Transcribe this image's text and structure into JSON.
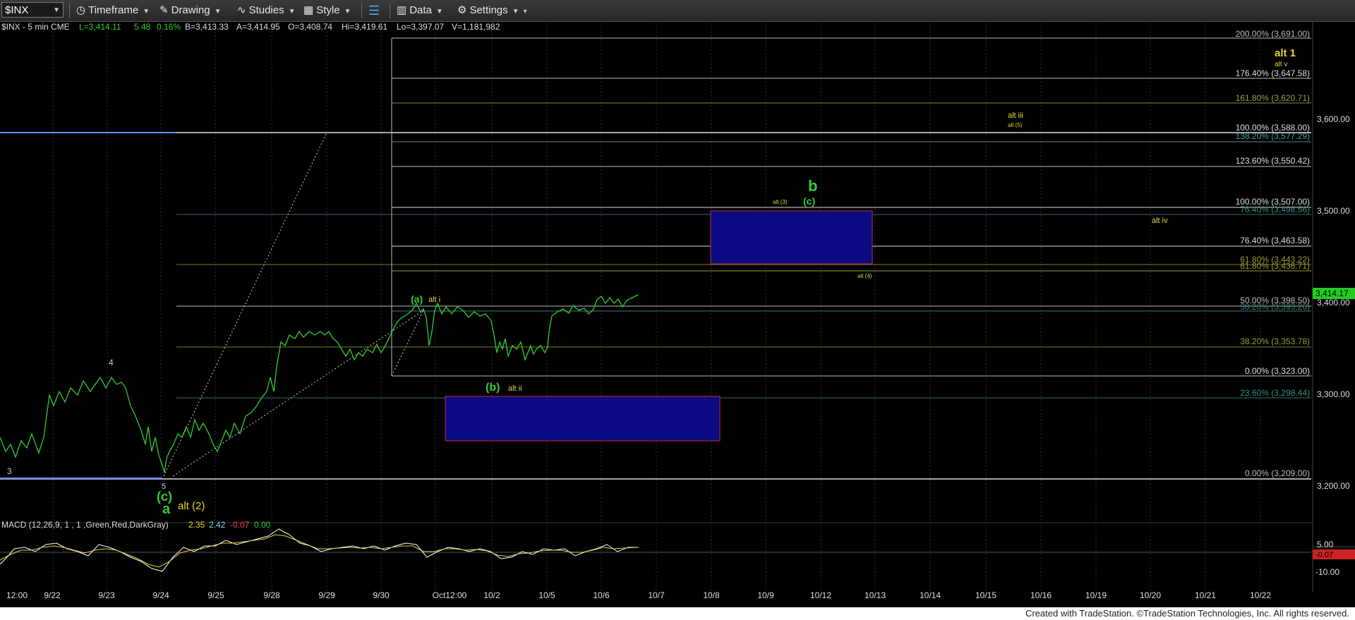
{
  "toolbar": {
    "symbol": "$INX",
    "timeframe": "Timeframe",
    "drawing": "Drawing",
    "studies": "Studies",
    "style": "Style",
    "data": "Data",
    "settings": "Settings"
  },
  "header": {
    "title": "$INX - 5 min  CME",
    "L": "L=3,414.11",
    "chg": "5.48",
    "pct": "0.16%",
    "B": "B=3,413.33",
    "A": "A=3,414.95",
    "O": "O=3,408.74",
    "Hi": "Hi=3,419.61",
    "Lo": "Lo=3,397.07",
    "V": "V=1,181,982"
  },
  "price_axis": [
    "3,600.00",
    "3,500.00",
    "3,400.00",
    "3,300.00",
    "3,200.00"
  ],
  "last_price": "3,414.17",
  "date_axis": [
    "12:00",
    "9/22",
    "9/23",
    "9/24",
    "9/25",
    "9/28",
    "9/29",
    "9/30",
    "Oct12:00",
    "10/2",
    "10/5",
    "10/6",
    "10/7",
    "10/8",
    "10/9",
    "10/12",
    "10/13",
    "10/14",
    "10/15",
    "10/16",
    "10/19",
    "10/20",
    "10/21",
    "10/22"
  ],
  "fib_labels": [
    "200.00% (3,691.00)",
    "176.40% (3,647.58)",
    "161.80% (3,620.71)",
    "100.00% (3,588.00)",
    "138.20% (3,577.29)",
    "123.60% (3,550.42)",
    "100.00% (3,507.00)",
    "76.40% (3,498.56)",
    "76.40% (3,463.58)",
    "61.80% (3,443.22)",
    "61.80% (3,436.71)",
    "50.00% (3,398.50)",
    "38.20% (3,393.26)",
    "38.20% (3,353.78)",
    "0.00% (3,323.00)",
    "23.60% (3,298.44)",
    "0.00% (3,209.00)"
  ],
  "wave_labels": {
    "alt1": "alt 1",
    "altv": "alt v",
    "altiii": "alt iii",
    "alt5": "alt (5)",
    "b": "b",
    "c": "(c)",
    "alt3": "alt (3)",
    "altiv": "alt iv",
    "alt4": "alt (4)",
    "a_paren": "(a)",
    "alti": "alt i",
    "b_paren": "(b)",
    "altii": "alt ii",
    "four": "4",
    "three": "3",
    "five": "5",
    "c_low": "(c)",
    "a_low": "a",
    "alt2": "alt (2)"
  },
  "macd": {
    "label": "MACD (12,26,9, 1 , 1 ,Green,Red,DarkGray)",
    "v1": "2.35",
    "v2": "2.42",
    "v3": "-0.07",
    "v4": "0.00",
    "axis_top": "5.00",
    "axis_bottom": "-10.00",
    "value": "-0.07"
  },
  "footer": "Created with TradeStation. ©TradeStation Technologies, Inc. All rights reserved.",
  "colors": {
    "green": "#33cc33",
    "yellow": "#e6d23c",
    "blue_box": "#0a0a82",
    "red_border": "#c8283c"
  }
}
